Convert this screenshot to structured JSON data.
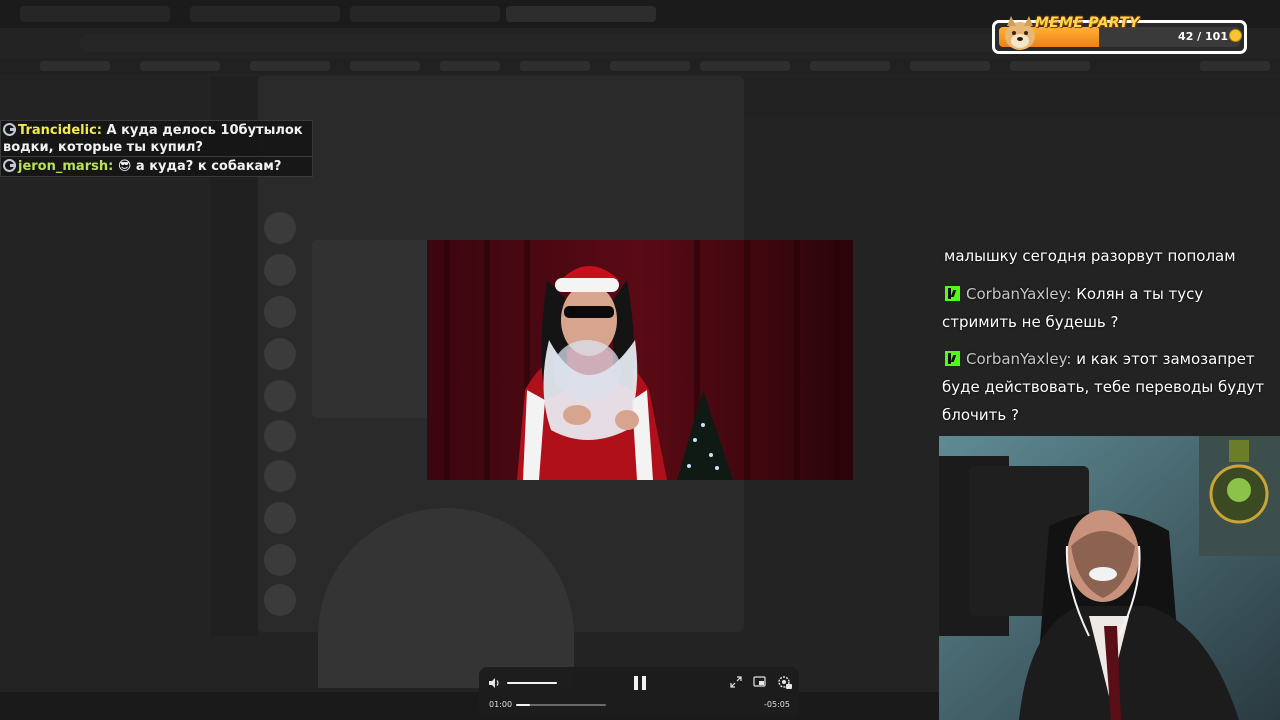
{
  "meme_party": {
    "title": "MEME PARTY",
    "count_label": "42 / 101",
    "progress_fraction": 0.416,
    "colors": {
      "fill": "#f59a20",
      "title": "#ffd84a"
    },
    "icon": "doge-icon",
    "coin_icon": "coin-icon"
  },
  "left_chat": [
    {
      "nick": "Trancidelic:",
      "message": "А куда делось 10бутылок",
      "message_cont": "водки, которые ты купил?",
      "nick_color": "#f2e94b",
      "badge": "g-badge-icon"
    },
    {
      "nick": "jeron_marsh:",
      "emoji": "😎",
      "message": "а куда? к собакам?",
      "nick_color": "#b8e05a",
      "badge": "g-badge-icon"
    }
  ],
  "right_chat": {
    "first_line": "малышку сегодня разорвут пополам",
    "messages": [
      {
        "nick": "CorbanYaxley:",
        "line1": "Колян а ты тусу",
        "line2": "стримить не будешь ?",
        "badge": "kick-icon"
      },
      {
        "nick": "CorbanYaxley:",
        "line1": "и как этот замозапрет",
        "line2": "буде действовать, тебе переводы будут",
        "line3": "блочить ?",
        "badge": "kick-icon"
      }
    ]
  },
  "player": {
    "current_time": "01:00",
    "remaining_time": "-05:05",
    "progress_fraction": 0.16,
    "volume_fraction": 1.0,
    "icons": [
      "volume-icon",
      "pause-icon",
      "fullscreen-icon",
      "pip-icon",
      "settings-icon"
    ]
  }
}
